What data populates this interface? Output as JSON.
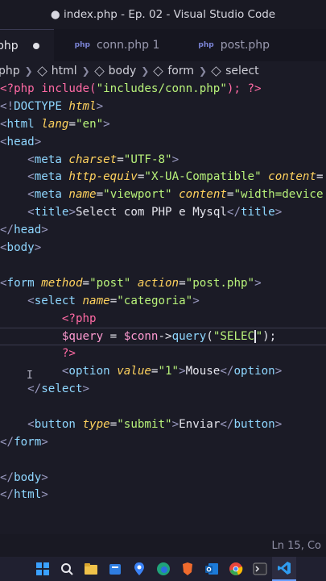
{
  "window": {
    "title": "● index.php - Ep. 02 - Visual Studio Code"
  },
  "tabs": [
    {
      "label": "php",
      "active": true
    },
    {
      "label": "conn.php 1",
      "active": false
    },
    {
      "label": "post.php",
      "active": false
    }
  ],
  "breadcrumb": [
    "php",
    "html",
    "body",
    "form",
    "select"
  ],
  "code": {
    "l1": [
      "<?php include(",
      "\"includes/conn.php\"",
      "); ?>"
    ],
    "l2": [
      "<!",
      "DOCTYPE",
      " html",
      ">"
    ],
    "l3": [
      "<",
      "html",
      " lang",
      "=",
      "\"en\"",
      ">"
    ],
    "l4": [
      "<",
      "head",
      ">"
    ],
    "l5": [
      "    <",
      "meta",
      " charset",
      "=",
      "\"UTF-8\"",
      ">"
    ],
    "l6": [
      "    <",
      "meta",
      " http-equiv",
      "=",
      "\"X-UA-Compatible\"",
      " content",
      "="
    ],
    "l7": [
      "    <",
      "meta",
      " name",
      "=",
      "\"viewport\"",
      " content",
      "=",
      "\"width=device"
    ],
    "l8": [
      "    <",
      "title",
      ">",
      "Select com PHP e Mysql",
      "</",
      "title",
      ">"
    ],
    "l9": [
      "</",
      "head",
      ">"
    ],
    "l10": [
      "<",
      "body",
      ">"
    ],
    "l12": [
      "<",
      "form",
      " method",
      "=",
      "\"post\"",
      " action",
      "=",
      "\"post.php\"",
      ">"
    ],
    "l13": [
      "    <",
      "select",
      " name",
      "=",
      "\"categoria\"",
      ">"
    ],
    "l14": [
      "         <?php"
    ],
    "l15": [
      "         ",
      "$query",
      " = ",
      "$conn",
      "->",
      "query",
      "(",
      "\"SELEC",
      "\"",
      ");"
    ],
    "l16": [
      "         ?>"
    ],
    "l17": [
      "         <",
      "option",
      " value",
      "=",
      "\"1\"",
      ">",
      "Mouse",
      "</",
      "option",
      ">"
    ],
    "l18": [
      "    </",
      "select",
      ">"
    ],
    "l20": [
      "    <",
      "button",
      " type",
      "=",
      "\"submit\"",
      ">",
      "Enviar",
      "</",
      "button",
      ">"
    ],
    "l21": [
      "</",
      "form",
      ">"
    ],
    "l23": [
      "</",
      "body",
      ">"
    ],
    "l24": [
      "</",
      "html",
      ">"
    ]
  },
  "status": {
    "position": "Ln 15, Co"
  },
  "taskbar": [
    "windows-start",
    "search",
    "file-explorer",
    "folder",
    "maps",
    "edge",
    "brave",
    "outlook",
    "chrome",
    "terminal",
    "vscode"
  ]
}
